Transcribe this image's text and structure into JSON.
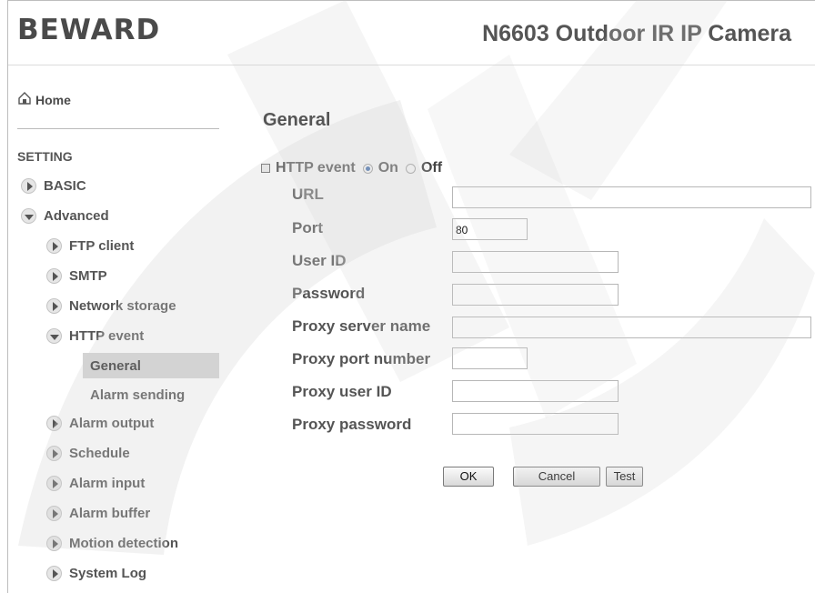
{
  "header": {
    "logo_text": "BEWARD",
    "camera_title": "N6603 Outdoor IR IP Camera"
  },
  "sidebar": {
    "home_label": "Home",
    "setting_label": "SETTING",
    "items": [
      {
        "label": "BASIC",
        "expanded": false
      },
      {
        "label": "Advanced",
        "expanded": true
      },
      {
        "label": "FTP client",
        "expanded": false
      },
      {
        "label": "SMTP",
        "expanded": false
      },
      {
        "label": "Network storage",
        "expanded": false
      },
      {
        "label": "HTTP event",
        "expanded": true
      },
      {
        "label": "General",
        "selected": true
      },
      {
        "label": "Alarm sending",
        "selected": false
      },
      {
        "label": "Alarm output",
        "expanded": false
      },
      {
        "label": "Schedule",
        "expanded": false
      },
      {
        "label": "Alarm input",
        "expanded": false
      },
      {
        "label": "Alarm buffer",
        "expanded": false
      },
      {
        "label": "Motion detection",
        "expanded": false
      },
      {
        "label": "System Log",
        "expanded": false
      }
    ]
  },
  "main": {
    "title": "General",
    "http_event": {
      "label": "HTTP event",
      "on_label": "On",
      "off_label": "Off",
      "selected": "On"
    },
    "fields": [
      {
        "label": "URL",
        "value": ""
      },
      {
        "label": "Port",
        "value": "80"
      },
      {
        "label": "User ID",
        "value": ""
      },
      {
        "label": "Password",
        "value": ""
      },
      {
        "label": "Proxy server name",
        "value": ""
      },
      {
        "label": "Proxy port number",
        "value": ""
      },
      {
        "label": "Proxy user ID",
        "value": ""
      },
      {
        "label": "Proxy password",
        "value": ""
      }
    ],
    "buttons": {
      "ok": "OK",
      "cancel": "Cancel",
      "test": "Test"
    }
  },
  "colors": {
    "accent_radio": "#2d5fa8",
    "selected_item_bg": "#d4d4d4",
    "text_gray": "#555555"
  }
}
